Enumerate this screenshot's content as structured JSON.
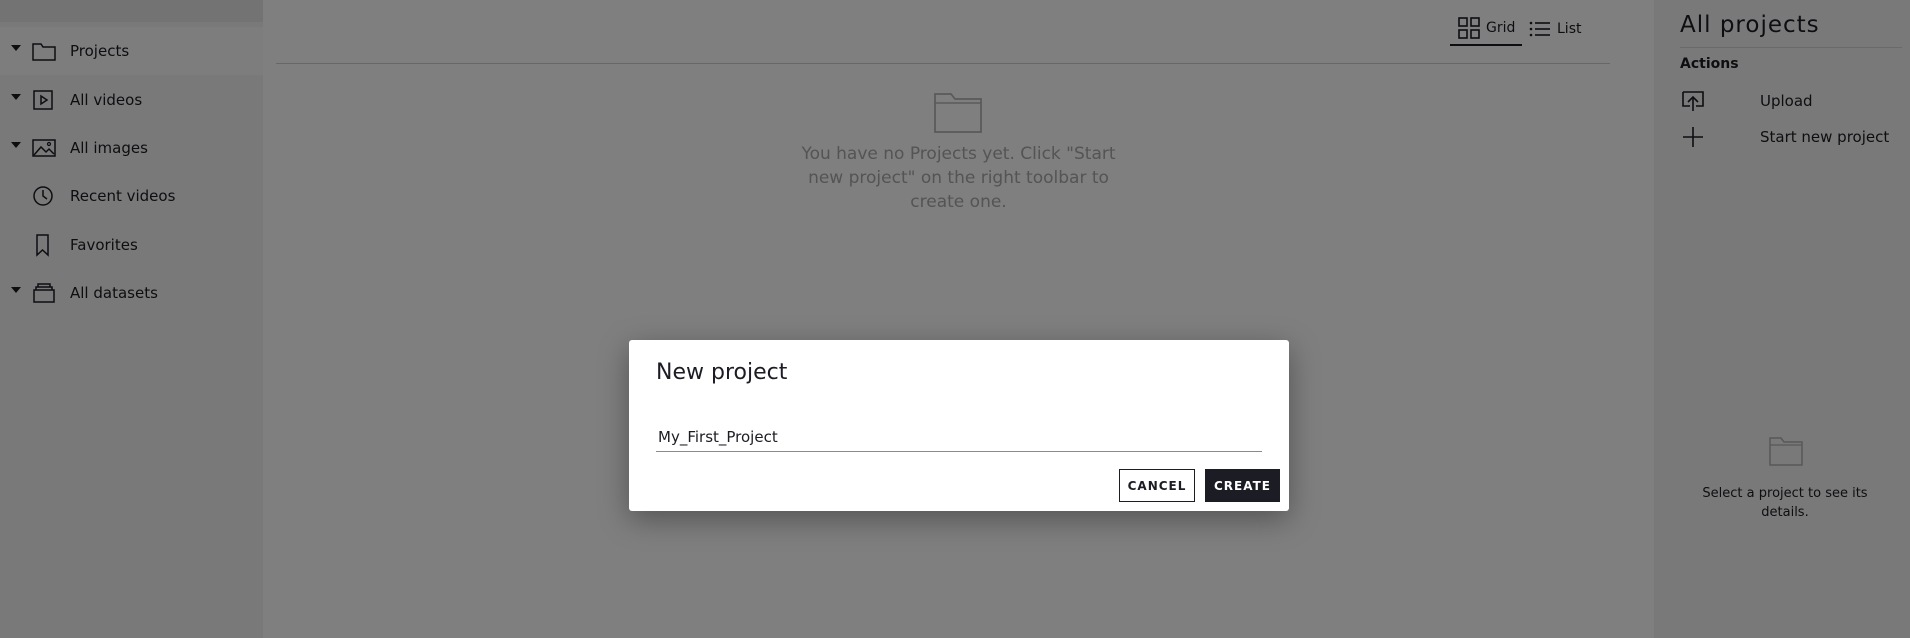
{
  "sidebar": {
    "items": [
      {
        "label": "Projects",
        "icon": "folder-icon",
        "has_caret": true,
        "active": true
      },
      {
        "label": "All videos",
        "icon": "video-icon",
        "has_caret": true,
        "active": false
      },
      {
        "label": "All images",
        "icon": "image-icon",
        "has_caret": true,
        "active": false
      },
      {
        "label": "Recent videos",
        "icon": "clock-icon",
        "has_caret": false,
        "active": false
      },
      {
        "label": "Favorites",
        "icon": "bookmark-icon",
        "has_caret": false,
        "active": false
      },
      {
        "label": "All datasets",
        "icon": "dataset-icon",
        "has_caret": true,
        "active": false
      }
    ]
  },
  "view_toggle": {
    "grid_label": "Grid",
    "list_label": "List",
    "selected": "grid"
  },
  "main": {
    "empty_message": "You have no Projects yet. Click \"Start new project\" on the right toolbar to create one."
  },
  "right_panel": {
    "title": "All projects",
    "actions_label": "Actions",
    "actions": [
      {
        "label": "Upload",
        "icon": "upload-icon"
      },
      {
        "label": "Start new project",
        "icon": "plus-icon"
      }
    ],
    "empty_message": "Select a project to see its details."
  },
  "modal": {
    "title": "New project",
    "input_value": "My_First_Project",
    "cancel_label": "CANCEL",
    "create_label": "CREATE"
  },
  "colors": {
    "dark": "#1c1c24",
    "panel_bg": "#f2f2f2",
    "overlay": "rgba(0,0,0,0.5)"
  }
}
